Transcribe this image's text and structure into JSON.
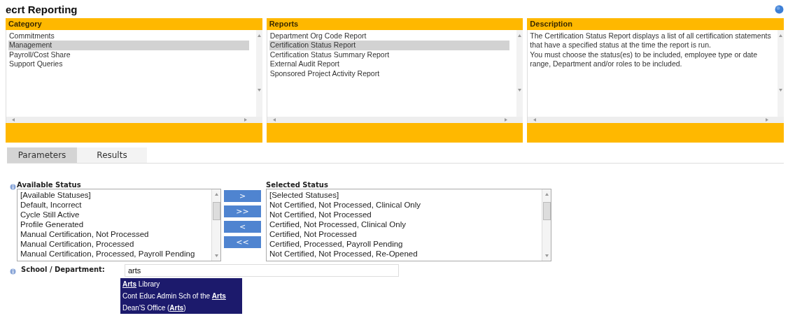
{
  "title": "ecrt Reporting",
  "panels": [
    {
      "heading": "Category",
      "kind": "list",
      "items": [
        {
          "label": "Commitments",
          "selected": false
        },
        {
          "label": "Management",
          "selected": true
        },
        {
          "label": "Payroll/Cost Share",
          "selected": false
        },
        {
          "label": "Support Queries",
          "selected": false
        }
      ]
    },
    {
      "heading": "Reports",
      "kind": "list",
      "items": [
        {
          "label": "Department Org Code Report",
          "selected": false
        },
        {
          "label": "Certification Status Report",
          "selected": true
        },
        {
          "label": "Certification Status Summary Report",
          "selected": false
        },
        {
          "label": "External Audit Report",
          "selected": false
        },
        {
          "label": "Sponsored Project Activity Report",
          "selected": false
        }
      ]
    },
    {
      "heading": "Description",
      "kind": "text",
      "lines": [
        "The Certification Status Report displays a list of all certification statements that have a specified status at the time the report is run.",
        "You must choose the status(es) to be included, employee type or date range, Department and/or roles to be included."
      ]
    }
  ],
  "tabs": [
    {
      "label": "Parameters",
      "selected": true
    },
    {
      "label": "Results",
      "selected": false
    }
  ],
  "available_status": {
    "label": "Available Status",
    "items": [
      "[Available Statuses]",
      "Default, Incorrect",
      "Cycle Still Active",
      "Profile Generated",
      "Manual Certification, Not Processed",
      "Manual Certification, Processed",
      "Manual Certification, Processed, Payroll Pending"
    ]
  },
  "move_buttons": [
    ">",
    ">>",
    "<",
    "<<"
  ],
  "selected_status": {
    "label": "Selected Status",
    "items": [
      "[Selected Statuses]",
      "Not Certified, Not Processed, Clinical Only",
      "Not Certified, Not Processed",
      "Certified, Not Processed, Clinical Only",
      "Certified, Not Processed",
      "Certified, Processed, Payroll Pending",
      "Not Certified, Not Processed, Re-Opened"
    ]
  },
  "school_department": {
    "label": "School / Department:",
    "value": "arts",
    "suggestions": [
      "**Arts** Library",
      "Cont Educ Admin Sch of the **Arts**",
      "Dean'S Office (**Arts**)"
    ]
  }
}
